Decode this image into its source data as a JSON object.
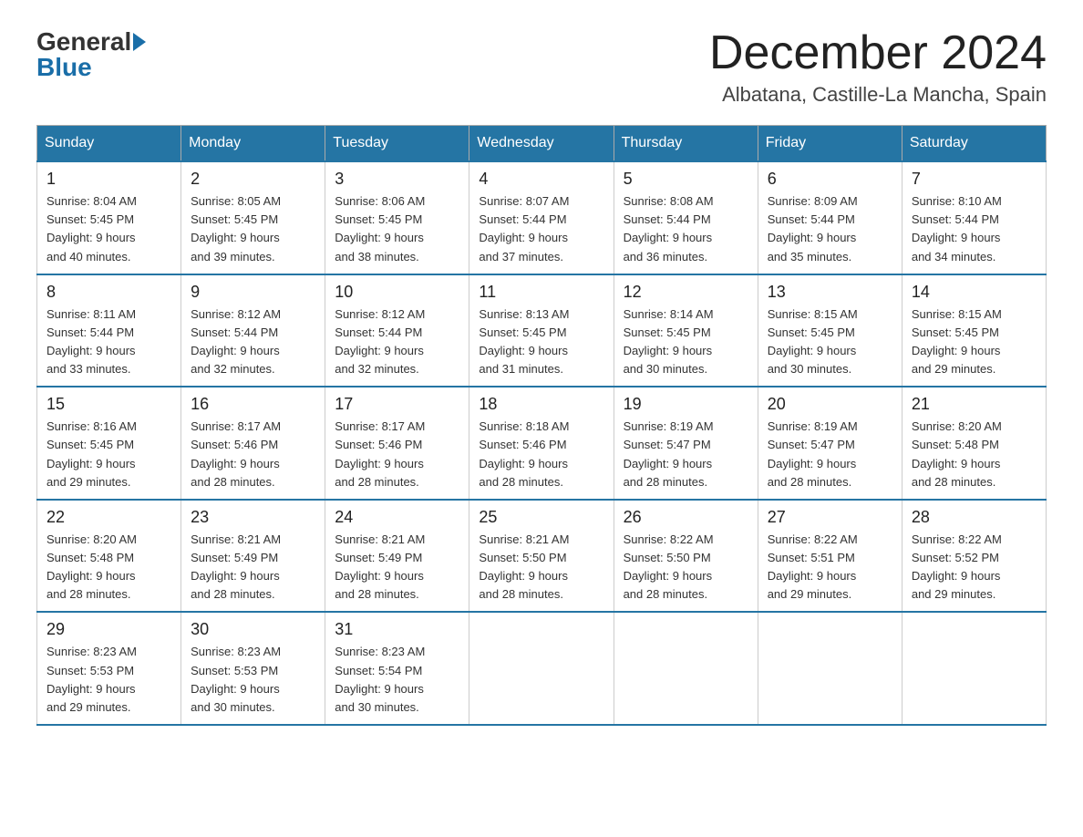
{
  "logo": {
    "general": "General",
    "blue": "Blue"
  },
  "title": "December 2024",
  "location": "Albatana, Castille-La Mancha, Spain",
  "days_of_week": [
    "Sunday",
    "Monday",
    "Tuesday",
    "Wednesday",
    "Thursday",
    "Friday",
    "Saturday"
  ],
  "weeks": [
    [
      {
        "day": "1",
        "sunrise": "8:04 AM",
        "sunset": "5:45 PM",
        "daylight": "9 hours and 40 minutes."
      },
      {
        "day": "2",
        "sunrise": "8:05 AM",
        "sunset": "5:45 PM",
        "daylight": "9 hours and 39 minutes."
      },
      {
        "day": "3",
        "sunrise": "8:06 AM",
        "sunset": "5:45 PM",
        "daylight": "9 hours and 38 minutes."
      },
      {
        "day": "4",
        "sunrise": "8:07 AM",
        "sunset": "5:44 PM",
        "daylight": "9 hours and 37 minutes."
      },
      {
        "day": "5",
        "sunrise": "8:08 AM",
        "sunset": "5:44 PM",
        "daylight": "9 hours and 36 minutes."
      },
      {
        "day": "6",
        "sunrise": "8:09 AM",
        "sunset": "5:44 PM",
        "daylight": "9 hours and 35 minutes."
      },
      {
        "day": "7",
        "sunrise": "8:10 AM",
        "sunset": "5:44 PM",
        "daylight": "9 hours and 34 minutes."
      }
    ],
    [
      {
        "day": "8",
        "sunrise": "8:11 AM",
        "sunset": "5:44 PM",
        "daylight": "9 hours and 33 minutes."
      },
      {
        "day": "9",
        "sunrise": "8:12 AM",
        "sunset": "5:44 PM",
        "daylight": "9 hours and 32 minutes."
      },
      {
        "day": "10",
        "sunrise": "8:12 AM",
        "sunset": "5:44 PM",
        "daylight": "9 hours and 32 minutes."
      },
      {
        "day": "11",
        "sunrise": "8:13 AM",
        "sunset": "5:45 PM",
        "daylight": "9 hours and 31 minutes."
      },
      {
        "day": "12",
        "sunrise": "8:14 AM",
        "sunset": "5:45 PM",
        "daylight": "9 hours and 30 minutes."
      },
      {
        "day": "13",
        "sunrise": "8:15 AM",
        "sunset": "5:45 PM",
        "daylight": "9 hours and 30 minutes."
      },
      {
        "day": "14",
        "sunrise": "8:15 AM",
        "sunset": "5:45 PM",
        "daylight": "9 hours and 29 minutes."
      }
    ],
    [
      {
        "day": "15",
        "sunrise": "8:16 AM",
        "sunset": "5:45 PM",
        "daylight": "9 hours and 29 minutes."
      },
      {
        "day": "16",
        "sunrise": "8:17 AM",
        "sunset": "5:46 PM",
        "daylight": "9 hours and 28 minutes."
      },
      {
        "day": "17",
        "sunrise": "8:17 AM",
        "sunset": "5:46 PM",
        "daylight": "9 hours and 28 minutes."
      },
      {
        "day": "18",
        "sunrise": "8:18 AM",
        "sunset": "5:46 PM",
        "daylight": "9 hours and 28 minutes."
      },
      {
        "day": "19",
        "sunrise": "8:19 AM",
        "sunset": "5:47 PM",
        "daylight": "9 hours and 28 minutes."
      },
      {
        "day": "20",
        "sunrise": "8:19 AM",
        "sunset": "5:47 PM",
        "daylight": "9 hours and 28 minutes."
      },
      {
        "day": "21",
        "sunrise": "8:20 AM",
        "sunset": "5:48 PM",
        "daylight": "9 hours and 28 minutes."
      }
    ],
    [
      {
        "day": "22",
        "sunrise": "8:20 AM",
        "sunset": "5:48 PM",
        "daylight": "9 hours and 28 minutes."
      },
      {
        "day": "23",
        "sunrise": "8:21 AM",
        "sunset": "5:49 PM",
        "daylight": "9 hours and 28 minutes."
      },
      {
        "day": "24",
        "sunrise": "8:21 AM",
        "sunset": "5:49 PM",
        "daylight": "9 hours and 28 minutes."
      },
      {
        "day": "25",
        "sunrise": "8:21 AM",
        "sunset": "5:50 PM",
        "daylight": "9 hours and 28 minutes."
      },
      {
        "day": "26",
        "sunrise": "8:22 AM",
        "sunset": "5:50 PM",
        "daylight": "9 hours and 28 minutes."
      },
      {
        "day": "27",
        "sunrise": "8:22 AM",
        "sunset": "5:51 PM",
        "daylight": "9 hours and 29 minutes."
      },
      {
        "day": "28",
        "sunrise": "8:22 AM",
        "sunset": "5:52 PM",
        "daylight": "9 hours and 29 minutes."
      }
    ],
    [
      {
        "day": "29",
        "sunrise": "8:23 AM",
        "sunset": "5:53 PM",
        "daylight": "9 hours and 29 minutes."
      },
      {
        "day": "30",
        "sunrise": "8:23 AM",
        "sunset": "5:53 PM",
        "daylight": "9 hours and 30 minutes."
      },
      {
        "day": "31",
        "sunrise": "8:23 AM",
        "sunset": "5:54 PM",
        "daylight": "9 hours and 30 minutes."
      },
      null,
      null,
      null,
      null
    ]
  ],
  "labels": {
    "sunrise": "Sunrise:",
    "sunset": "Sunset:",
    "daylight": "Daylight:"
  }
}
